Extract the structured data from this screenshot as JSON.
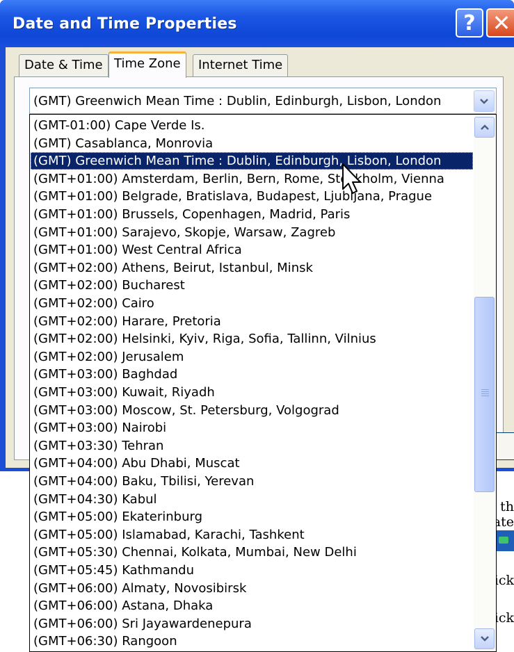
{
  "window": {
    "title": "Date and Time Properties",
    "help_label": "?",
    "close_label": "✕"
  },
  "tabs": [
    {
      "label": "Date & Time",
      "active": false
    },
    {
      "label": "Time Zone",
      "active": true
    },
    {
      "label": "Internet Time",
      "active": false
    }
  ],
  "timezone_combo": {
    "value": "(GMT) Greenwich Mean Time : Dublin, Edinburgh, Lisbon, London"
  },
  "timezone_list": {
    "selected_index": 2,
    "options": [
      "(GMT-01:00) Cape Verde Is.",
      "(GMT) Casablanca, Monrovia",
      "(GMT) Greenwich Mean Time : Dublin, Edinburgh, Lisbon, London",
      "(GMT+01:00) Amsterdam, Berlin, Bern, Rome, Stockholm, Vienna",
      "(GMT+01:00) Belgrade, Bratislava, Budapest, Ljubljana, Prague",
      "(GMT+01:00) Brussels, Copenhagen, Madrid, Paris",
      "(GMT+01:00) Sarajevo, Skopje, Warsaw, Zagreb",
      "(GMT+01:00) West Central Africa",
      "(GMT+02:00) Athens, Beirut, Istanbul, Minsk",
      "(GMT+02:00) Bucharest",
      "(GMT+02:00) Cairo",
      "(GMT+02:00) Harare, Pretoria",
      "(GMT+02:00) Helsinki, Kyiv, Riga, Sofia, Tallinn, Vilnius",
      "(GMT+02:00) Jerusalem",
      "(GMT+03:00) Baghdad",
      "(GMT+03:00) Kuwait, Riyadh",
      "(GMT+03:00) Moscow, St. Petersburg, Volgograd",
      "(GMT+03:00) Nairobi",
      "(GMT+03:30) Tehran",
      "(GMT+04:00) Abu Dhabi, Muscat",
      "(GMT+04:00) Baku, Tbilisi, Yerevan",
      "(GMT+04:30) Kabul",
      "(GMT+05:00) Ekaterinburg",
      "(GMT+05:00) Islamabad, Karachi, Tashkent",
      "(GMT+05:30) Chennai, Kolkata, Mumbai, New Delhi",
      "(GMT+05:45) Kathmandu",
      "(GMT+06:00) Almaty, Novosibirsk",
      "(GMT+06:00) Astana, Dhaka",
      "(GMT+06:00) Sri Jayawardenepura",
      "(GMT+06:30) Rangoon"
    ]
  },
  "background_page": {
    "fragments": [
      "t th",
      "ate",
      "lick",
      "lick"
    ]
  },
  "colors": {
    "titlebar": "#1b56e3",
    "selection": "#0a246a",
    "dialog_face": "#ece9d8",
    "active_tab_accent": "#f3b33d"
  },
  "icons": {
    "help": "question-mark",
    "close": "x-mark",
    "combo_arrow": "chevron-down",
    "scroll_up": "chevron-up",
    "scroll_down": "chevron-down",
    "pointer": "arrow-cursor"
  }
}
